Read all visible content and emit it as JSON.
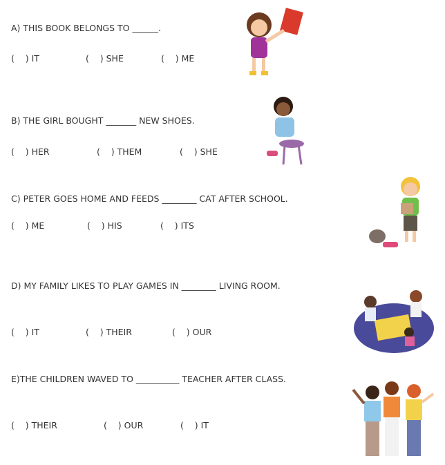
{
  "questions": [
    {
      "text": "A) THIS BOOK BELONGS TO ______.",
      "options": [
        "(    ) IT",
        "(    ) SHE",
        "(    ) ME"
      ],
      "image": "girl-holding-book"
    },
    {
      "text": "B) THE GIRL BOUGHT _______ NEW SHOES.",
      "options": [
        "(    ) HER",
        "(    ) THEM",
        "(    ) SHE"
      ],
      "image": "girl-putting-on-shoes"
    },
    {
      "text": "C) PETER GOES HOME AND FEEDS ________ CAT AFTER SCHOOL.",
      "options": [
        "(    ) ME",
        "(    ) HIS",
        "(    ) ITS"
      ],
      "image": "boy-feeding-cat"
    },
    {
      "text": "D) MY FAMILY LIKES TO PLAY GAMES IN ________ LIVING ROOM.",
      "options": [
        "(    ) IT",
        "(    ) THEIR",
        "(    ) OUR"
      ],
      "image": "family-playing-board-game"
    },
    {
      "text": "E)THE CHILDREN WAVED TO __________ TEACHER AFTER CLASS.",
      "options": [
        "(    ) THEIR",
        "(    ) OUR",
        "(    ) IT"
      ],
      "image": "children-waving"
    }
  ]
}
